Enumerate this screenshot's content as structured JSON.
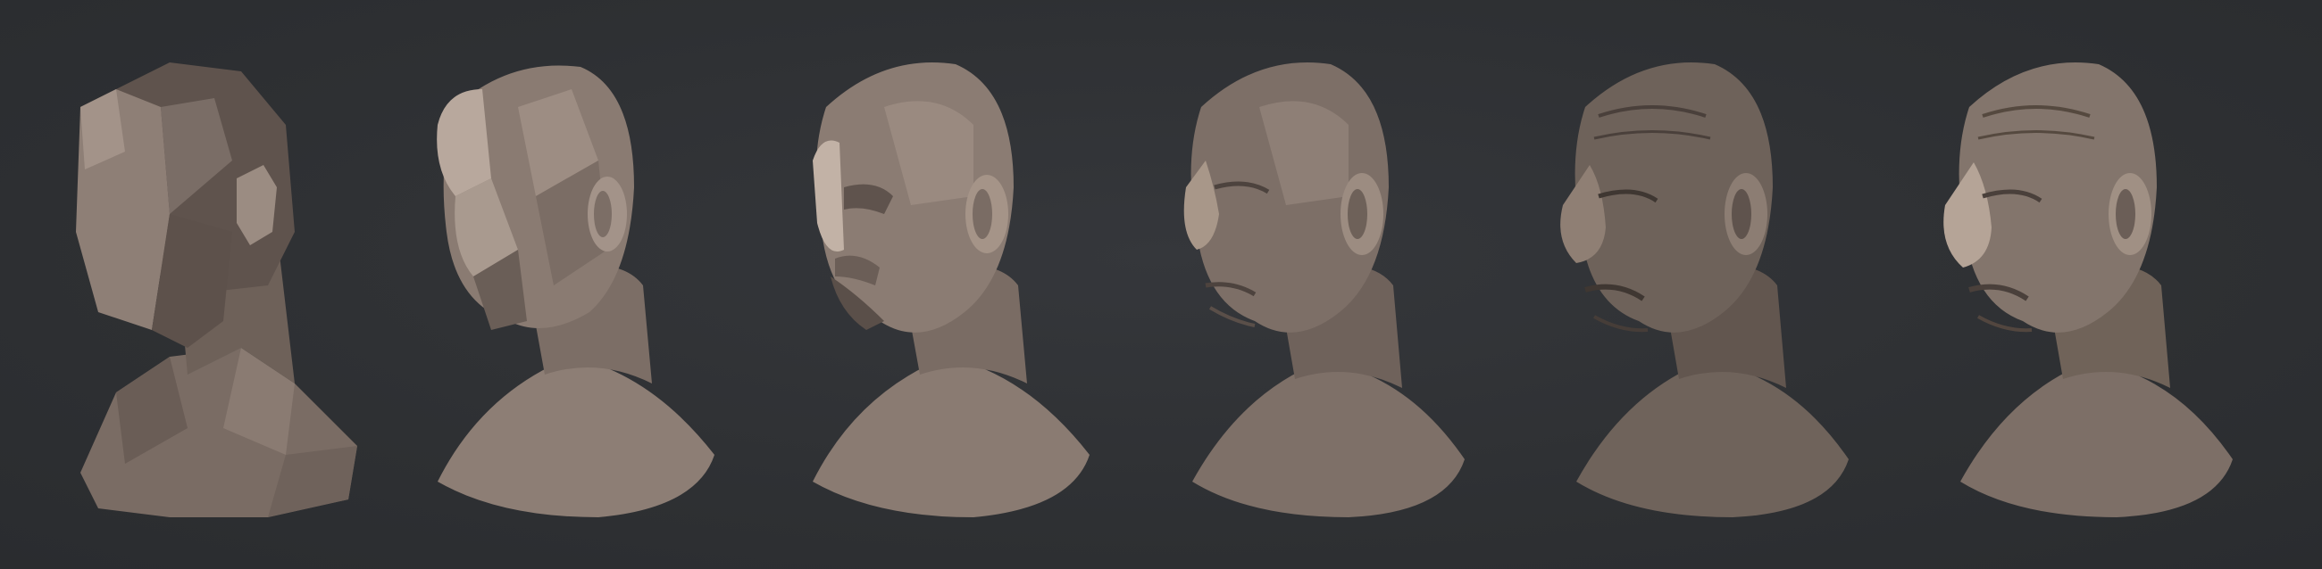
{
  "scene": {
    "background_color": "#2f3134",
    "material_color": "#8a7b72",
    "highlight_color": "#c7b6aa",
    "shadow_color": "#4a403b",
    "subject": "head-bust",
    "stages": [
      {
        "level": 1,
        "detail": "lowest-poly"
      },
      {
        "level": 2,
        "detail": "low-poly"
      },
      {
        "level": 3,
        "detail": "medium-poly"
      },
      {
        "level": 4,
        "detail": "medium-high-poly"
      },
      {
        "level": 5,
        "detail": "high-poly"
      },
      {
        "level": 6,
        "detail": "highest-poly"
      }
    ]
  }
}
